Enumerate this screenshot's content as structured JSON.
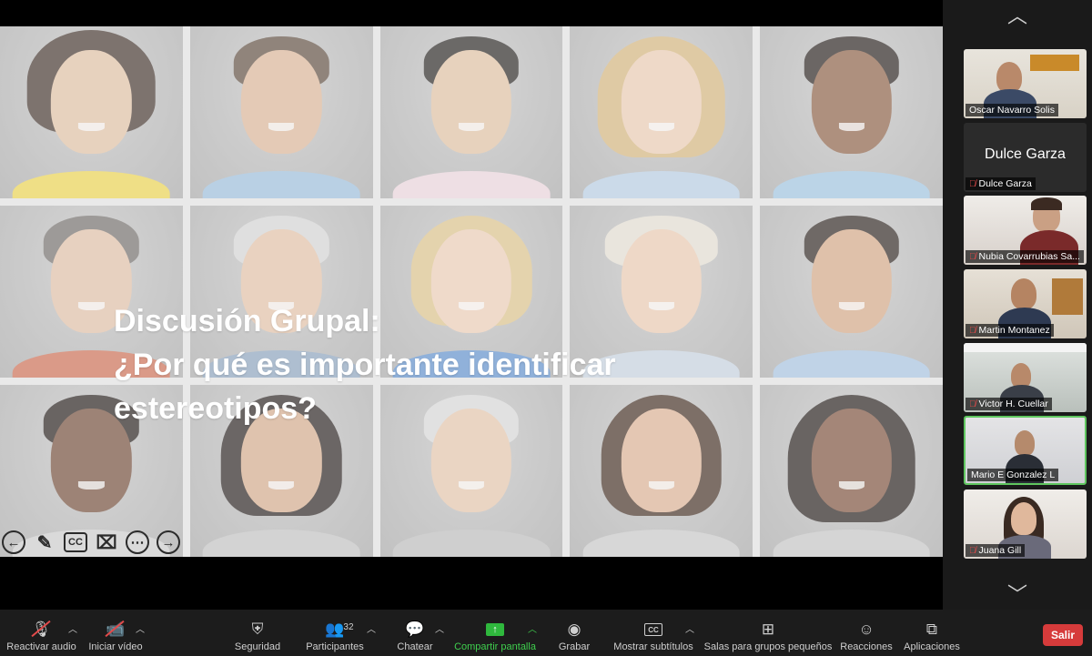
{
  "slide": {
    "title_line1": "Discusión Grupal:",
    "title_line2": "¿Por qué es importante identificar",
    "title_line3": "estereotipos?"
  },
  "annotation_tools": [
    {
      "name": "back-arrow-icon",
      "glyph": "←"
    },
    {
      "name": "pen-icon",
      "glyph": "✎"
    },
    {
      "name": "cc-icon",
      "glyph": "CC"
    },
    {
      "name": "camera-off-icon",
      "glyph": "⌧"
    },
    {
      "name": "more-icon",
      "glyph": "⋯"
    },
    {
      "name": "forward-arrow-icon",
      "glyph": "→"
    }
  ],
  "gallery": {
    "up_icon": "︿",
    "down_icon": "﹀",
    "participants": [
      {
        "name": "Oscar Navarro Solis",
        "muted": false,
        "video": true,
        "active": false
      },
      {
        "name": "Dulce Garza",
        "muted": true,
        "video": false,
        "active": false,
        "big_name": "Dulce Garza"
      },
      {
        "name": "Nubia Covarrubias Sa...",
        "muted": true,
        "video": true,
        "active": false
      },
      {
        "name": "Martin Montanez",
        "muted": true,
        "video": true,
        "active": false
      },
      {
        "name": "Victor H. Cuellar",
        "muted": true,
        "video": true,
        "active": false
      },
      {
        "name": "Mario E Gonzalez L",
        "muted": false,
        "video": true,
        "active": true
      },
      {
        "name": "Juana Gill",
        "muted": true,
        "video": true,
        "active": false
      }
    ]
  },
  "toolbar": {
    "audio": {
      "label": "Reactivar audio",
      "icon": "microphone-muted-icon"
    },
    "video": {
      "label": "Iniciar vídeo",
      "icon": "camera-off-icon"
    },
    "security": {
      "label": "Seguridad",
      "icon": "shield-icon"
    },
    "participants": {
      "label": "Participantes",
      "count": "32",
      "icon": "people-icon"
    },
    "chat": {
      "label": "Chatear",
      "icon": "chat-icon"
    },
    "share": {
      "label": "Compartir pantalla",
      "icon": "share-screen-icon"
    },
    "record": {
      "label": "Grabar",
      "icon": "record-icon"
    },
    "subtitles": {
      "label": "Mostrar subtítulos",
      "icon": "cc-icon",
      "icon_text": "CC"
    },
    "breakout": {
      "label": "Salas para grupos pequeños",
      "icon": "breakout-rooms-icon"
    },
    "reactions": {
      "label": "Reacciones",
      "icon": "emoji-icon"
    },
    "apps": {
      "label": "Aplicaciones",
      "icon": "apps-icon"
    },
    "leave": {
      "label": "Salir"
    }
  },
  "colors": {
    "accent_green": "#3fcf4e",
    "leave_red": "#d63b3b",
    "toolbar_bg": "#1c1c1c"
  }
}
